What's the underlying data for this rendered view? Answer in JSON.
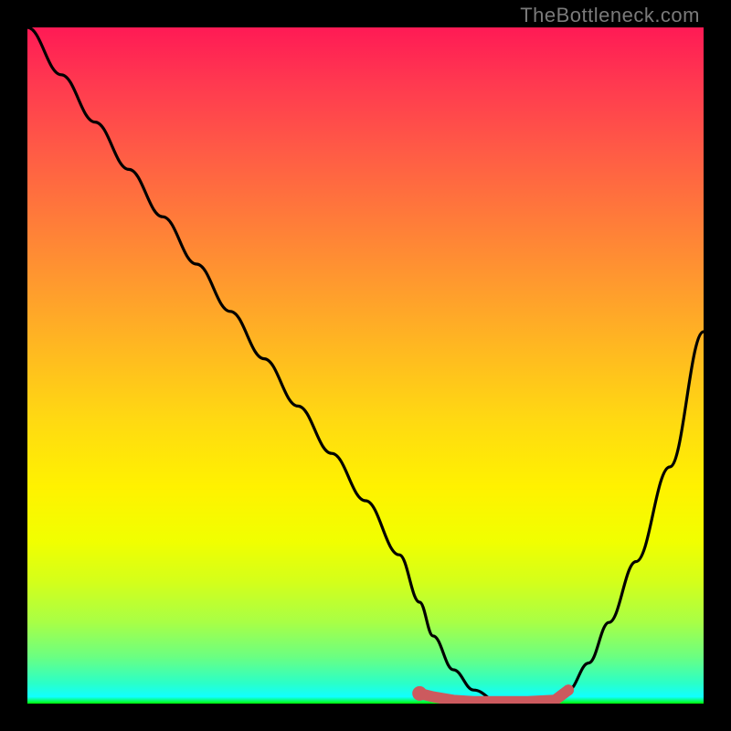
{
  "watermark": "TheBottleneck.com",
  "chart_data": {
    "type": "line",
    "title": "",
    "xlabel": "",
    "ylabel": "",
    "xlim": [
      0,
      100
    ],
    "ylim": [
      0,
      100
    ],
    "grid": false,
    "series": [
      {
        "name": "bottleneck-curve",
        "x": [
          0,
          5,
          10,
          15,
          20,
          25,
          30,
          35,
          40,
          45,
          50,
          55,
          58,
          60,
          63,
          66,
          70,
          74,
          78,
          80,
          83,
          86,
          90,
          95,
          100
        ],
        "values": [
          100,
          93,
          86,
          79,
          72,
          65,
          58,
          51,
          44,
          37,
          30,
          22,
          15,
          10,
          5,
          2,
          0,
          0,
          0,
          2,
          6,
          12,
          21,
          35,
          55
        ]
      }
    ],
    "markers": {
      "name": "highlight-band",
      "color": "#cc5a5e",
      "x": [
        58,
        60,
        63,
        66,
        70,
        74,
        78,
        80
      ],
      "values": [
        1.5,
        1,
        0.5,
        0.3,
        0.3,
        0.3,
        0.5,
        2
      ]
    },
    "background": {
      "type": "vertical-gradient",
      "stops": [
        {
          "pos": 0,
          "color": "#ff1a55"
        },
        {
          "pos": 50,
          "color": "#ffd400"
        },
        {
          "pos": 100,
          "color": "#00ff66"
        }
      ]
    }
  }
}
